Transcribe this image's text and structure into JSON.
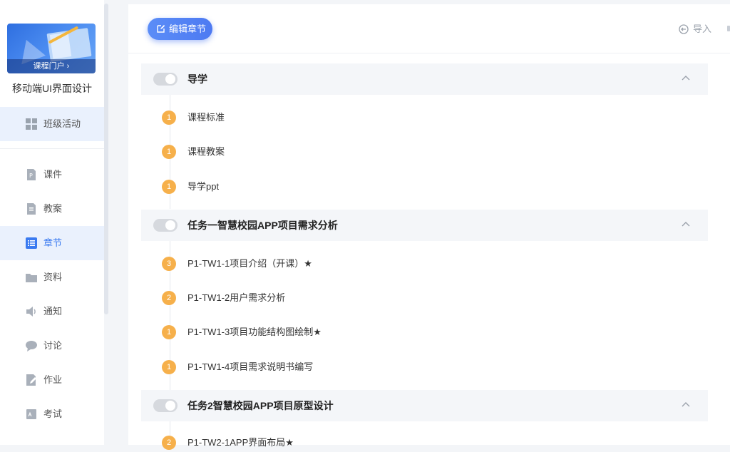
{
  "sidebar": {
    "cover_badge": "课程门户 ›",
    "course_title": "移动端UI界面设计",
    "items": [
      {
        "label": "班级活动"
      },
      {
        "label": "课件"
      },
      {
        "label": "教案"
      },
      {
        "label": "章节"
      },
      {
        "label": "资料"
      },
      {
        "label": "通知"
      },
      {
        "label": "讨论"
      },
      {
        "label": "作业"
      },
      {
        "label": "考试"
      }
    ]
  },
  "toolbar": {
    "edit_label": "编辑章节",
    "import_label": "导入"
  },
  "chapters": [
    {
      "title": "导学",
      "items": [
        {
          "num": "1",
          "label": "课程标准"
        },
        {
          "num": "1",
          "label": "课程教案"
        },
        {
          "num": "1",
          "label": "导学ppt"
        }
      ]
    },
    {
      "title": "任务一智慧校园APP项目需求分析",
      "items": [
        {
          "num": "3",
          "label": "P1-TW1-1项目介绍（开课）★"
        },
        {
          "num": "2",
          "label": "P1-TW1-2用户需求分析"
        },
        {
          "num": "1",
          "label": "P1-TW1-3项目功能结构图绘制★"
        },
        {
          "num": "1",
          "label": "P1-TW1-4项目需求说明书编写"
        }
      ]
    },
    {
      "title": "任务2智慧校园APP项目原型设计",
      "items": [
        {
          "num": "2",
          "label": "P1-TW2-1APP界面布局★"
        }
      ]
    }
  ],
  "colors": {
    "accent": "#3a7af0",
    "badge_orange": "#f6b04b"
  }
}
